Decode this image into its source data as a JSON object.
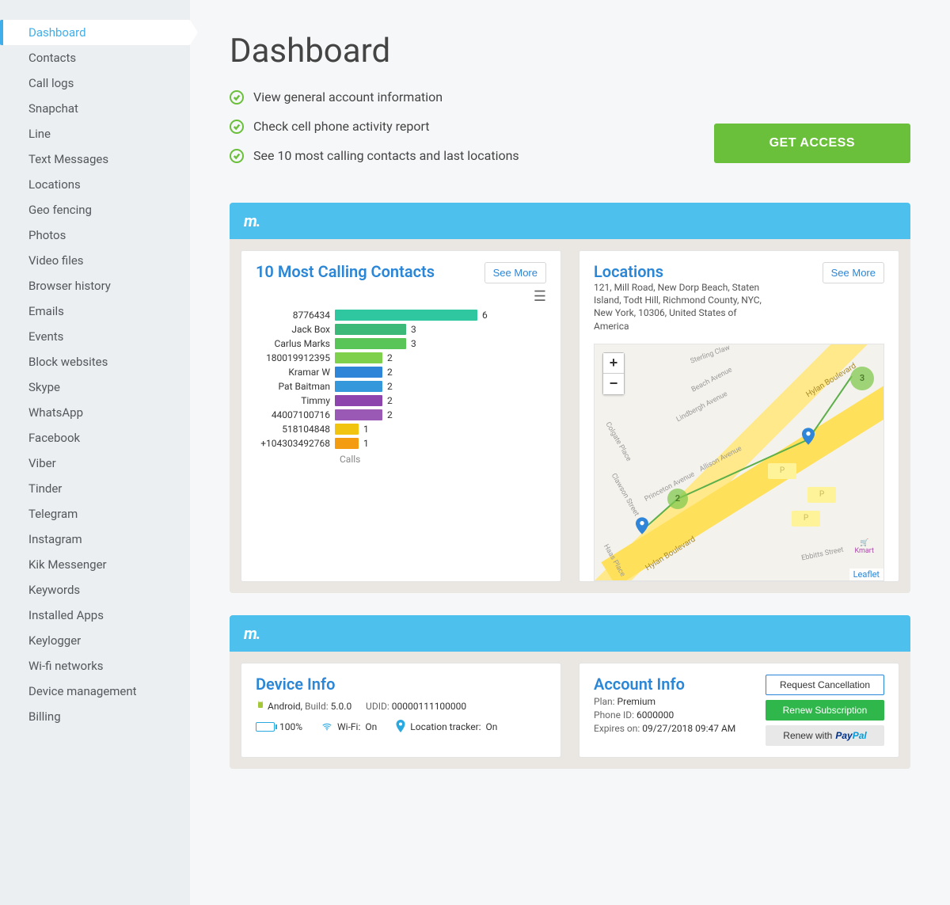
{
  "sidebar": {
    "items": [
      "Dashboard",
      "Contacts",
      "Call logs",
      "Snapchat",
      "Line",
      "Text Messages",
      "Locations",
      "Geo fencing",
      "Photos",
      "Video files",
      "Browser history",
      "Emails",
      "Events",
      "Block websites",
      "Skype",
      "WhatsApp",
      "Facebook",
      "Viber",
      "Tinder",
      "Telegram",
      "Instagram",
      "Kik Messenger",
      "Keywords",
      "Installed Apps",
      "Keylogger",
      "Wi-fi networks",
      "Device management",
      "Billing"
    ],
    "activeIndex": 0
  },
  "page": {
    "title": "Dashboard"
  },
  "hero": {
    "bullets": [
      "View general account information",
      "Check cell phone activity report",
      "See 10 most calling contacts and last locations"
    ],
    "cta": "GET ACCESS"
  },
  "topContacts": {
    "title": "10 Most Calling Contacts",
    "seeMore": "See More",
    "axisLabel": "Calls"
  },
  "locations": {
    "title": "Locations",
    "seeMore": "See More",
    "address": "121, Mill Road, New Dorp Beach, Staten Island, Todt Hill, Richmond County, NYC, New York, 10306, United States of America",
    "leaflet": "Leaflet",
    "roads": [
      "Hylan Boulevard",
      "Hylan Boulevard"
    ],
    "streets": [
      "Sterling Claw",
      "Beach Avenue",
      "Lindbergh Avenue",
      "Allison Avenue",
      "Clawson Street",
      "Princeton Avenue",
      "Ebbitts Street",
      "Haas Place",
      "Colgate Place"
    ],
    "bubbles": [
      "2",
      "3"
    ],
    "kmart": "Kmart"
  },
  "deviceInfo": {
    "title": "Device Info",
    "osLabel": "Android,",
    "buildLabel": "Build:",
    "buildValue": "5.0.0",
    "udidLabel": "UDID:",
    "udidValue": "00000111100000",
    "battery": "100%",
    "wifiLabel": "Wi-Fi:",
    "wifiValue": "On",
    "locLabel": "Location tracker:",
    "locValue": "On"
  },
  "accountInfo": {
    "title": "Account Info",
    "planLabel": "Plan:",
    "planValue": "Premium",
    "phoneIdLabel": "Phone ID:",
    "phoneIdValue": "6000000",
    "expiresLabel": "Expires on:",
    "expiresValue": "09/27/2018 09:47 AM",
    "buttons": {
      "cancel": "Request Cancellation",
      "renew": "Renew Subscription",
      "paypalPrefix": "Renew with",
      "paypal1": "Pay",
      "paypal2": "Pal"
    }
  },
  "chart_data": {
    "type": "bar",
    "title": "10 Most Calling Contacts",
    "xlabel": "Calls",
    "ylabel": "",
    "categories": [
      "8776434",
      "Jack Box",
      "Carlus Marks",
      "180019912395",
      "Kramar W",
      "Pat Baitman",
      "Timmy",
      "44007100716",
      "518104848",
      "+104303492768"
    ],
    "values": [
      6,
      3,
      3,
      2,
      2,
      2,
      2,
      2,
      1,
      1
    ],
    "colors": [
      "#2ec7a0",
      "#3cb878",
      "#59c559",
      "#7fd04d",
      "#2f86d9",
      "#3498db",
      "#8e44ad",
      "#9b59b6",
      "#f1c40f",
      "#f39c12"
    ],
    "xlim": [
      0,
      6
    ]
  }
}
